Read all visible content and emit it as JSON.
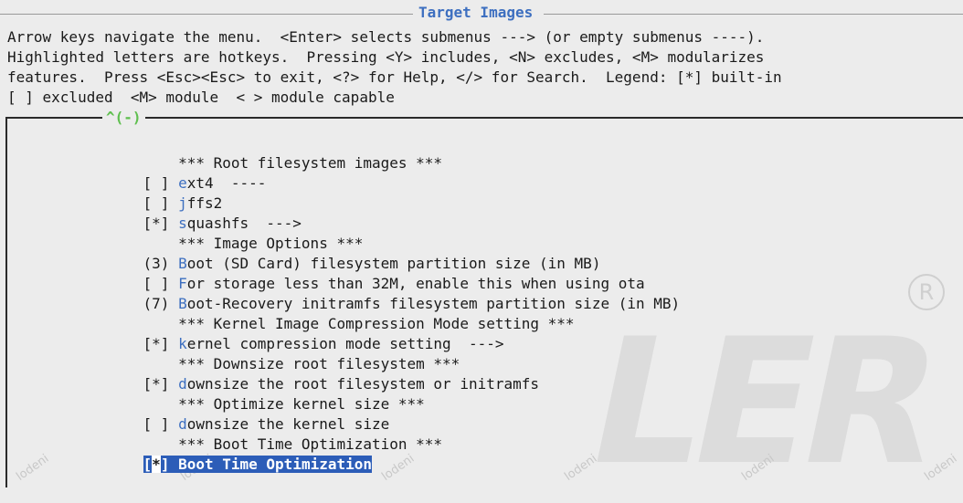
{
  "header": {
    "title": "Target Images",
    "help_lines": [
      "Arrow keys navigate the menu.  <Enter> selects submenus ---> (or empty submenus ----).",
      "Highlighted letters are hotkeys.  Pressing <Y> includes, <N> excludes, <M> modularizes",
      "features.  Press <Esc><Esc> to exit, <?> for Help, </> for Search.  Legend: [*] built-in",
      "[ ] excluded  <M> module  < > module capable"
    ]
  },
  "menu": {
    "scroll_indicator": "^(-)",
    "items": [
      {
        "prefix": "    ",
        "hot": "",
        "rest": "*** Root filesystem images ***",
        "interactable": false
      },
      {
        "prefix": "[ ] ",
        "hot": "e",
        "rest": "xt4  ----",
        "interactable": true
      },
      {
        "prefix": "[ ] ",
        "hot": "j",
        "rest": "ffs2",
        "interactable": true
      },
      {
        "prefix": "[*] ",
        "hot": "s",
        "rest": "quashfs  --->",
        "interactable": true
      },
      {
        "prefix": "    ",
        "hot": "",
        "rest": "*** Image Options ***",
        "interactable": false
      },
      {
        "prefix": "(3) ",
        "hot": "B",
        "rest": "oot (SD Card) filesystem partition size (in MB)",
        "interactable": true
      },
      {
        "prefix": "[ ] ",
        "hot": "F",
        "rest": "or storage less than 32M, enable this when using ota",
        "interactable": true
      },
      {
        "prefix": "(7) ",
        "hot": "B",
        "rest": "oot-Recovery initramfs filesystem partition size (in MB)",
        "interactable": true
      },
      {
        "prefix": "    ",
        "hot": "",
        "rest": "*** Kernel Image Compression Mode setting ***",
        "interactable": false
      },
      {
        "prefix": "[*] ",
        "hot": "k",
        "rest": "ernel compression mode setting  --->",
        "interactable": true
      },
      {
        "prefix": "    ",
        "hot": "",
        "rest": "*** Downsize root filesystem ***",
        "interactable": false
      },
      {
        "prefix": "[*] ",
        "hot": "d",
        "rest": "ownsize the root filesystem or initramfs",
        "interactable": true
      },
      {
        "prefix": "    ",
        "hot": "",
        "rest": "*** Optimize kernel size ***",
        "interactable": false
      },
      {
        "prefix": "[ ] ",
        "hot": "d",
        "rest": "ownsize the kernel size",
        "interactable": true
      },
      {
        "prefix": "    ",
        "hot": "",
        "rest": "*** Boot Time Optimization ***",
        "interactable": false
      }
    ],
    "selected": {
      "open": "[",
      "cursor": "*",
      "close": "] ",
      "hot": "B",
      "rest": "oot Time Optimization"
    }
  },
  "watermark": {
    "big": "LER",
    "small": "lodeni"
  },
  "colors": {
    "hotkey": "#3d6fc0",
    "selection": "#2c5db8",
    "scroll": "#5fbf4f"
  }
}
